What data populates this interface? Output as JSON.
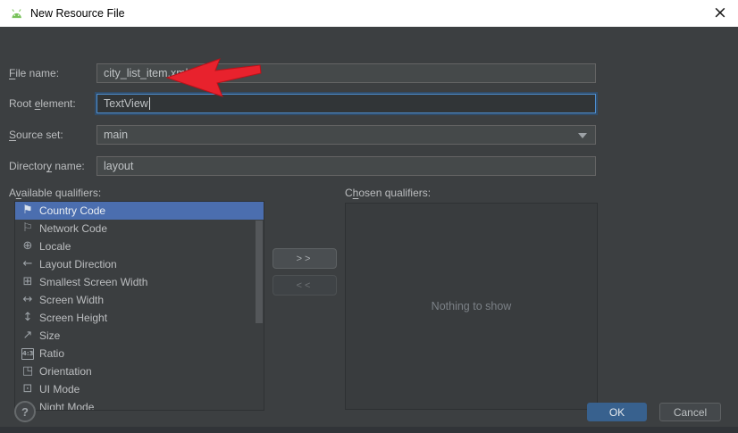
{
  "window": {
    "title": "New Resource File",
    "close_glyph": "×"
  },
  "form": {
    "file_name": {
      "label_pre": "",
      "label_u": "F",
      "label_post": "ile name:",
      "value": "city_list_item.xml"
    },
    "root_element": {
      "label_pre": "Root ",
      "label_u": "e",
      "label_post": "lement:",
      "value": "TextView"
    },
    "source_set": {
      "label_pre": "",
      "label_u": "S",
      "label_post": "ource set:",
      "value": "main"
    },
    "directory_name": {
      "label_pre": "Director",
      "label_u": "y",
      "label_post": " name:",
      "value": "layout"
    }
  },
  "qualifiers": {
    "available_label": {
      "pre": "A",
      "u": "v",
      "post": "ailable qualifiers:"
    },
    "chosen_label": {
      "pre": "C",
      "u": "h",
      "post": "osen qualifiers:"
    },
    "items": [
      {
        "label": "Country Code",
        "icon": "country-code",
        "glyph": "⚑",
        "selected": true
      },
      {
        "label": "Network Code",
        "icon": "network-code",
        "glyph": "⚐",
        "selected": false
      },
      {
        "label": "Locale",
        "icon": "locale",
        "glyph": "⊕",
        "selected": false
      },
      {
        "label": "Layout Direction",
        "icon": "layout-direction",
        "glyph": "←",
        "selected": false
      },
      {
        "label": "Smallest Screen Width",
        "icon": "smallest-screen-width",
        "glyph": "⊞",
        "selected": false
      },
      {
        "label": "Screen Width",
        "icon": "screen-width",
        "glyph": "↔",
        "selected": false
      },
      {
        "label": "Screen Height",
        "icon": "screen-height",
        "glyph": "↕",
        "selected": false
      },
      {
        "label": "Size",
        "icon": "size",
        "glyph": "↗",
        "selected": false
      },
      {
        "label": "Ratio",
        "icon": "ratio",
        "glyph": "4:3",
        "selected": false
      },
      {
        "label": "Orientation",
        "icon": "orientation",
        "glyph": "◳",
        "selected": false
      },
      {
        "label": "UI Mode",
        "icon": "ui-mode",
        "glyph": "⊡",
        "selected": false
      },
      {
        "label": "Night Mode",
        "icon": "night-mode",
        "glyph": "◐",
        "selected": false
      }
    ],
    "empty_text": "Nothing to show",
    "add_button_label": ">>",
    "remove_button_label": "<<"
  },
  "footer": {
    "help_label": "?",
    "ok_label": "OK",
    "cancel_label": "Cancel"
  },
  "colors": {
    "titlebar_bg": "#ffffff",
    "dialog_bg": "#3c3f41",
    "selection_blue": "#4b6eaf",
    "focus_blue": "#4e8fd0",
    "ok_button_blue": "#38618e",
    "arrow_red": "#e8222d"
  }
}
